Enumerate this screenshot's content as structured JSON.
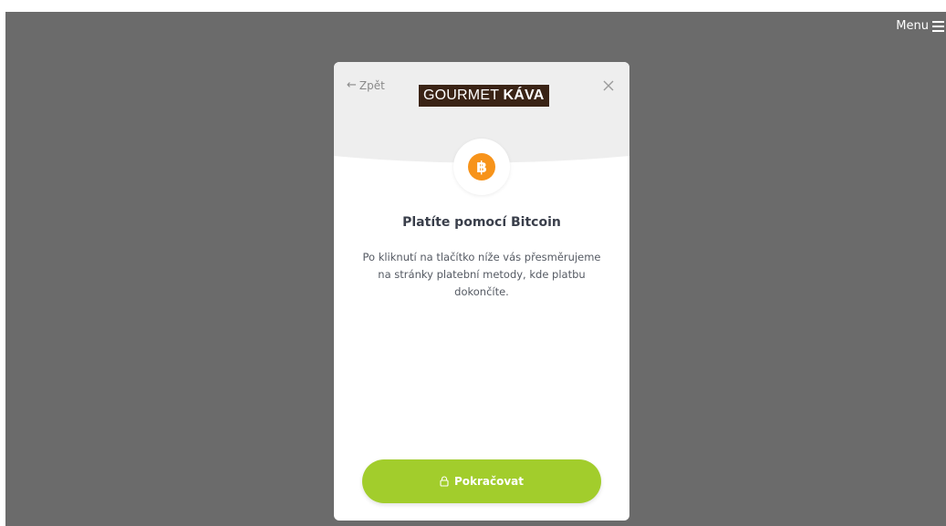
{
  "header": {
    "menu_label": "Menu"
  },
  "modal": {
    "back_label": "Zpět",
    "logo": {
      "text_regular": "GOURMET",
      "text_bold": "KÁVA"
    },
    "title": "Platíte pomocí Bitcoin",
    "description": "Po kliknutí na tlačítko níže vás přesměrujeme na stránky platební metody, kde platbu dokončíte.",
    "continue_label": "Pokračovat"
  },
  "icons": {
    "menu": "hamburger-icon",
    "back": "arrow-left-icon",
    "close": "close-icon",
    "payment": "bitcoin-icon",
    "lock": "lock-icon"
  },
  "colors": {
    "overlay": "#6b6b6b",
    "header_bg": "#eeeeee",
    "logo_bg": "#3a2315",
    "bitcoin": "#f7931a",
    "button": "#a2cd2c",
    "title": "#3a3f4b"
  }
}
